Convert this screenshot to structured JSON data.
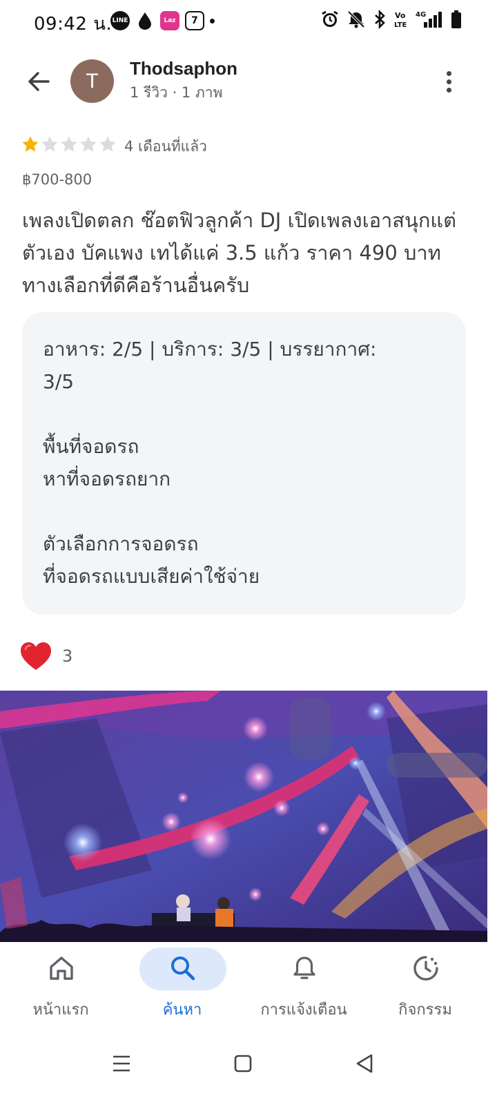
{
  "status_bar": {
    "time": "09:42 น.",
    "app_badges": [
      "LINE",
      "",
      "Laz",
      "7"
    ],
    "network": "4G",
    "volte": "Vo LTE"
  },
  "header": {
    "avatar_letter": "T",
    "reviewer_name": "Thodsaphon",
    "reviewer_meta": "1 รีวิว · 1 ภาพ"
  },
  "rating": {
    "stars": 1,
    "max_stars": 5,
    "time_ago": "4 เดือนที่แล้ว"
  },
  "price_range": "฿700-800",
  "review_text": "เพลงเปิดตลก ช๊อตฟิวลูกค้า DJ เปิดเพลงเอาสนุกแต่ตัวเอง บัคแพง เทได้แค่ 3.5 แก้ว ราคา 490 บาท ทางเลือกที่ดีคือร้านอื่นครับ",
  "attributes": {
    "scores_line1": "อาหาร: 2/5  |  บริการ: 3/5  |  บรรยากาศ:",
    "scores_line2": "3/5",
    "parking_label": "พื้นที่จอดรถ",
    "parking_value": "หาที่จอดรถยาก",
    "parking_option_label": "ตัวเลือกการจอดรถ",
    "parking_option_value": "ที่จอดรถแบบเสียค่าใช้จ่าย"
  },
  "reactions": {
    "count": "3"
  },
  "bottom_nav": {
    "items": [
      {
        "label": "หน้าแรก",
        "icon": "home-icon"
      },
      {
        "label": "ค้นหา",
        "icon": "search-icon"
      },
      {
        "label": "การแจ้งเตือน",
        "icon": "bell-icon"
      },
      {
        "label": "กิจกรรม",
        "icon": "activity-icon"
      }
    ],
    "active_index": 1
  },
  "colors": {
    "star_filled": "#f6b400",
    "star_empty": "#dadce0",
    "accent": "#1a6fd8",
    "active_pill": "#dde9fb",
    "card_bg": "#f4f5f7",
    "heart": "#e0252f"
  }
}
